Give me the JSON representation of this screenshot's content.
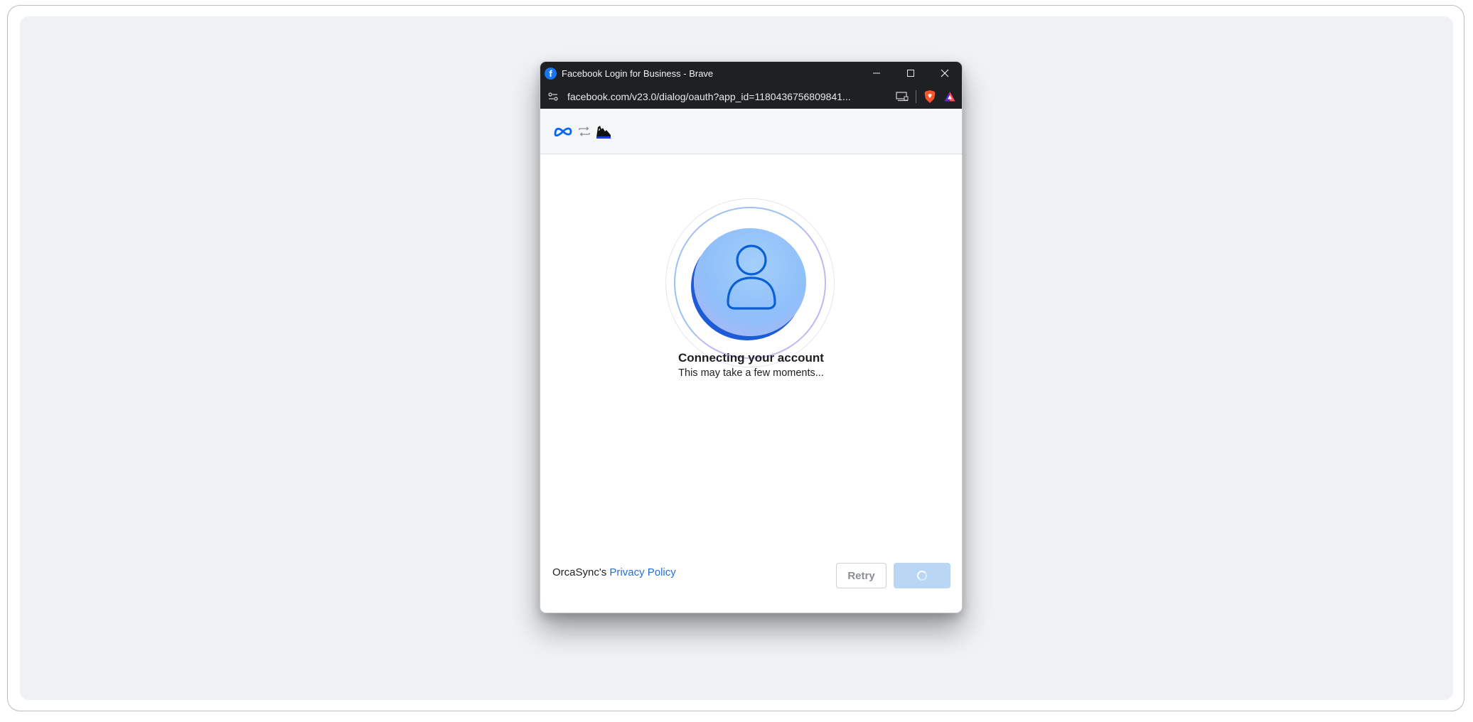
{
  "window": {
    "title": "Facebook Login for Business - Brave",
    "favicon_letter": "f",
    "url": "facebook.com/v23.0/dialog/oauth?app_id=1180436756809841..."
  },
  "dialog": {
    "status_title": "Connecting your account",
    "status_subtitle": "This may take a few moments...",
    "policy_prefix": "OrcaSync's ",
    "policy_link": "Privacy Policy",
    "retry_label": "Retry"
  },
  "colors": {
    "facebook_blue": "#1877f2",
    "meta_blue": "#0866ff",
    "brave_orange": "#fb542b",
    "link_blue": "#216fdb",
    "continue_disabled": "#b9d6f5"
  }
}
